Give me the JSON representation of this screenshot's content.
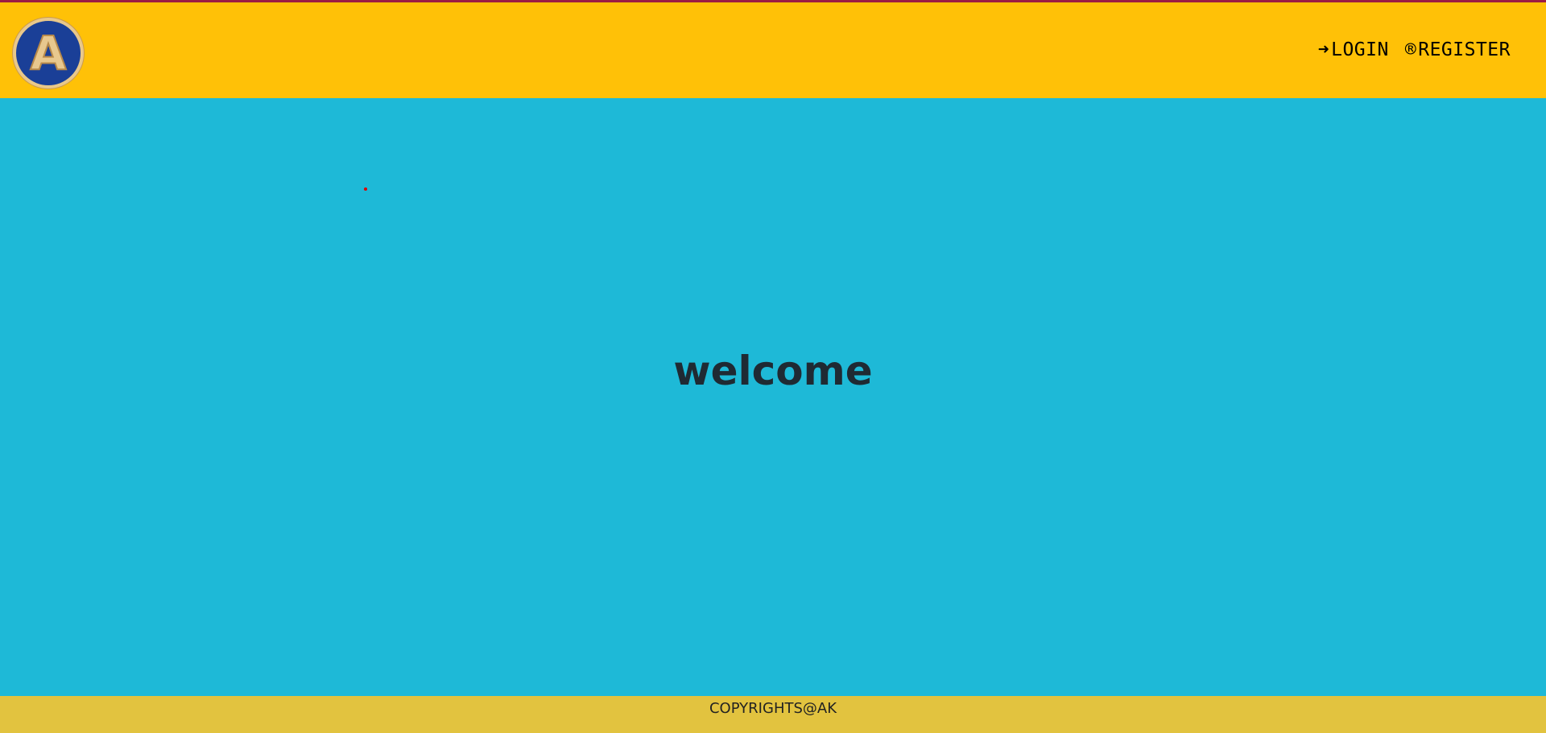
{
  "header": {
    "logo_letter": "A",
    "nav": [
      {
        "icon": "sign-in-icon",
        "glyph": "➜",
        "label": "LOGIN"
      },
      {
        "icon": "registered-icon",
        "glyph": "®",
        "label": "REGISTER"
      }
    ]
  },
  "main": {
    "heading": "welcome"
  },
  "footer": {
    "text": "COPYRIGHTS@AK"
  },
  "colors": {
    "header": "#ffc107",
    "main": "#1eb9d7",
    "footer": "#e2c33f",
    "top_border": "#9c1c44"
  }
}
